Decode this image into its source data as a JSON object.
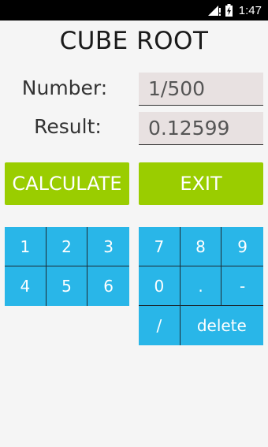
{
  "status_bar": {
    "time": "1:47",
    "icons": [
      "signal-alert-icon",
      "battery-charging-icon"
    ]
  },
  "app": {
    "title": "CUBE ROOT"
  },
  "fields": {
    "number_label": "Number:",
    "number_value": "1/500",
    "result_label": "Result:",
    "result_value": "0.12599"
  },
  "buttons": {
    "calculate": "CALCULATE",
    "exit": "EXIT"
  },
  "keypad_left": [
    "1",
    "2",
    "3",
    "4",
    "5",
    "6"
  ],
  "keypad_right": [
    "7",
    "8",
    "9",
    "0",
    ".",
    "-",
    "/",
    "delete"
  ],
  "colors": {
    "action_green": "#9acd00",
    "keypad_blue": "#29b6e8",
    "field_bg": "#e8e1e1",
    "background": "#f5f5f5"
  }
}
